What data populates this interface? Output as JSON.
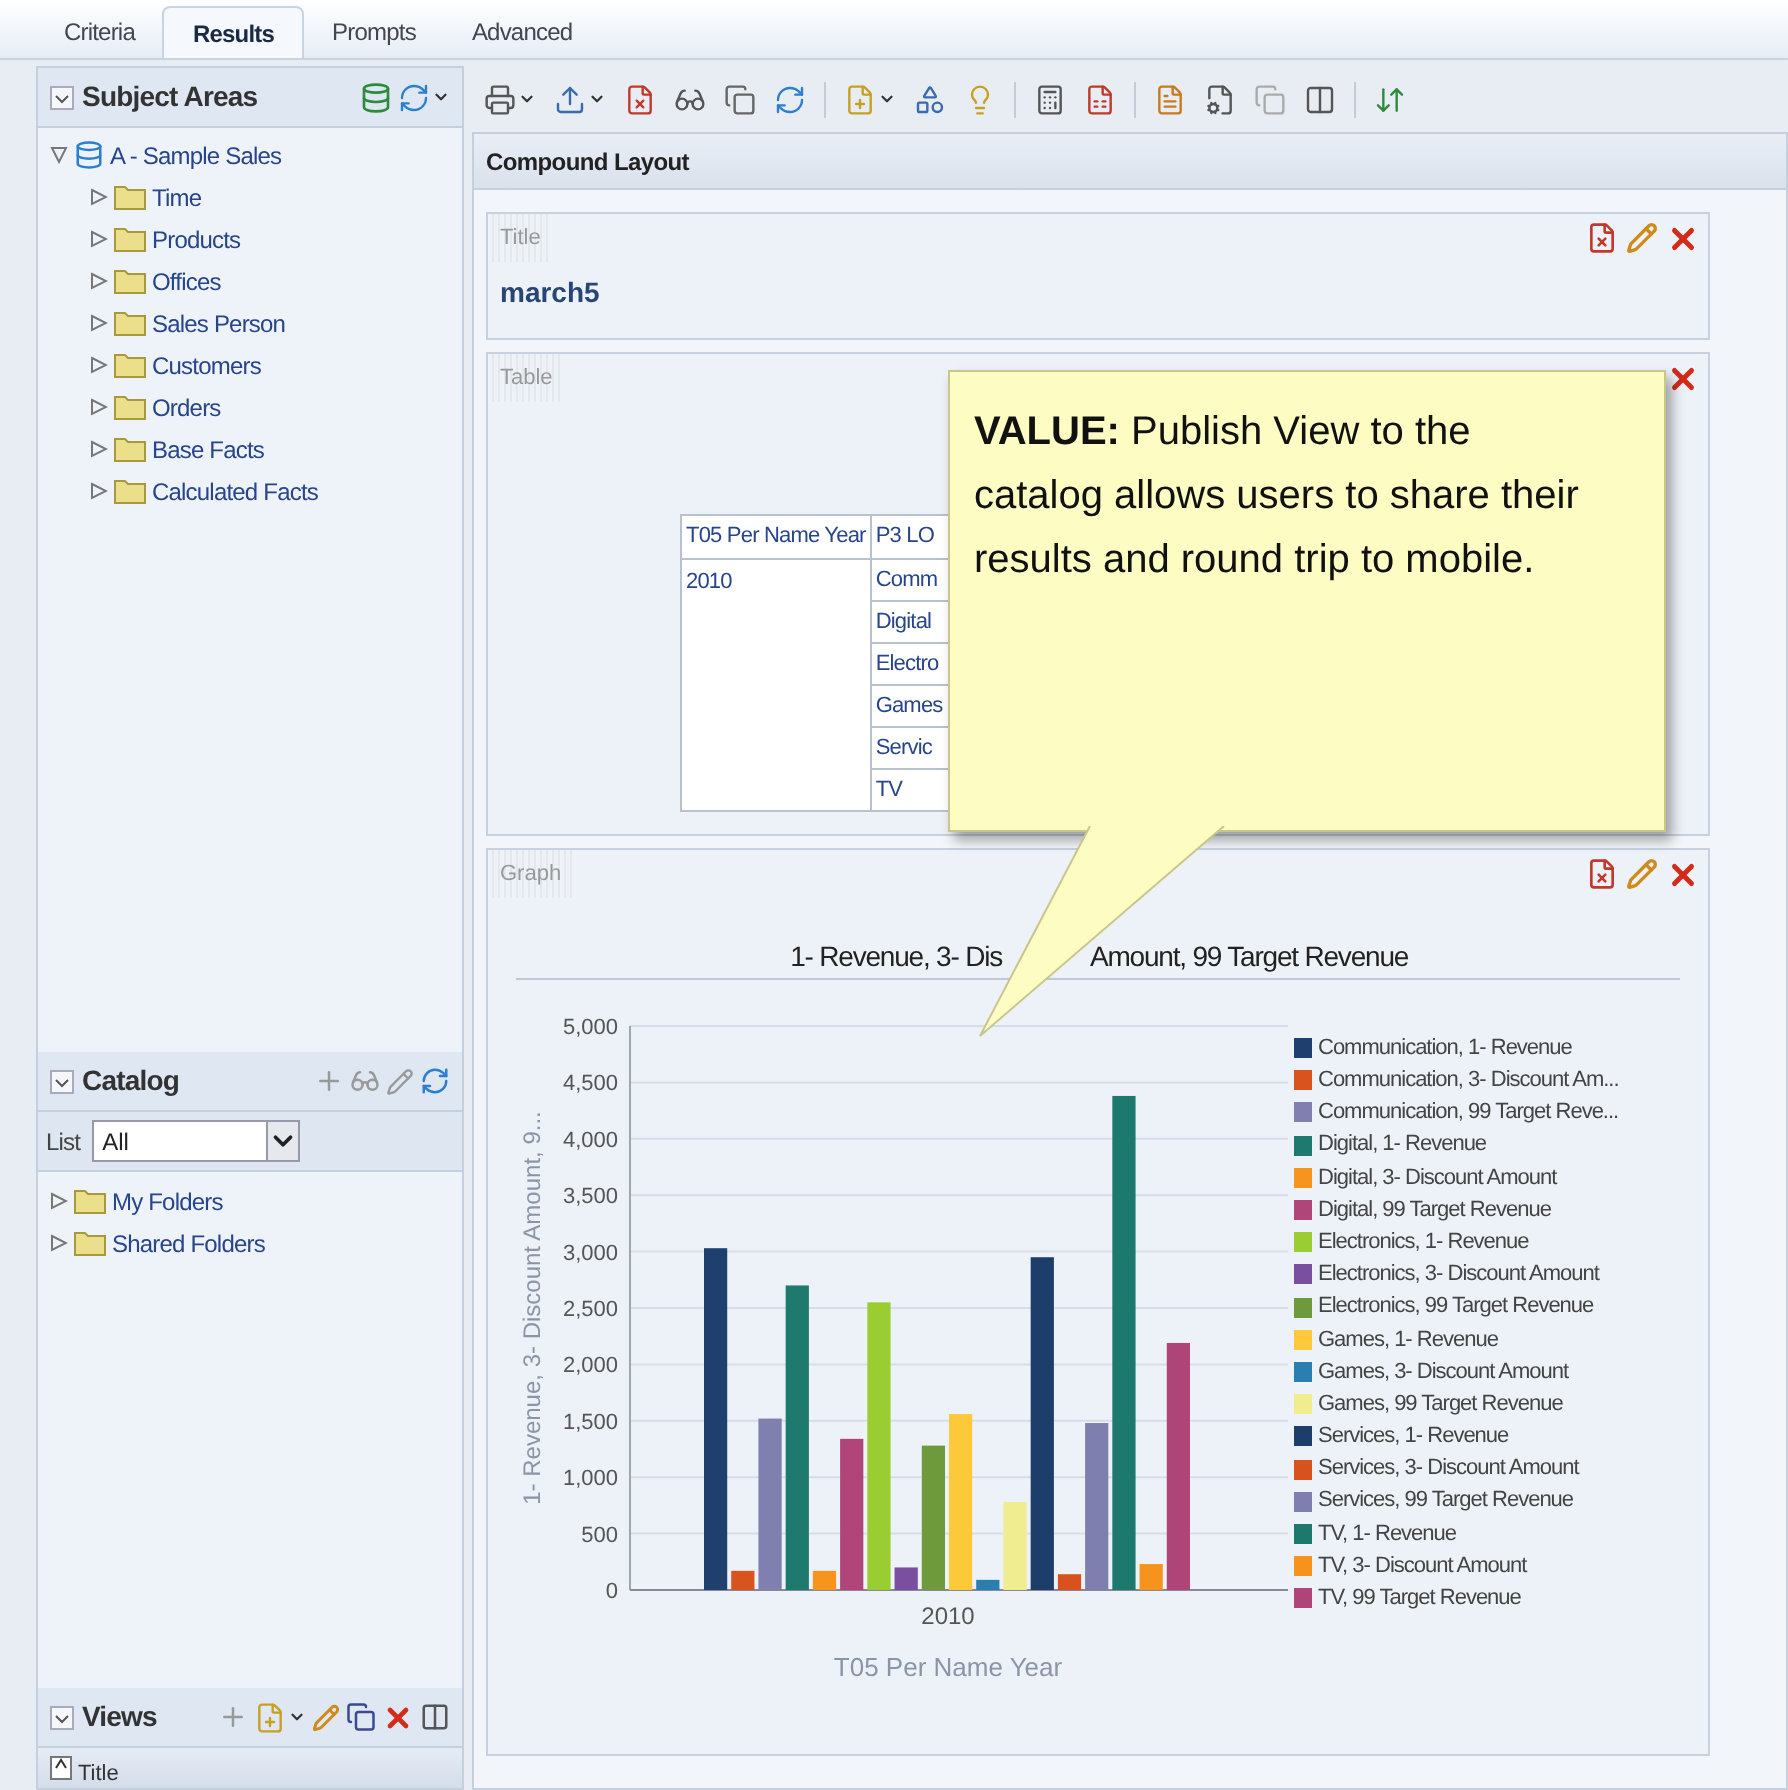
{
  "tabs": [
    {
      "label": "Criteria",
      "selected": false
    },
    {
      "label": "Results",
      "selected": true
    },
    {
      "label": "Prompts",
      "selected": false
    },
    {
      "label": "Advanced",
      "selected": false
    }
  ],
  "subject_areas": {
    "title": "Subject Areas",
    "tree": [
      {
        "label": "A - Sample Sales",
        "expanded": true,
        "children": [
          {
            "label": "Time",
            "expanded": false
          },
          {
            "label": "Products",
            "expanded": false
          },
          {
            "label": "Offices",
            "expanded": false
          },
          {
            "label": "Sales Person",
            "expanded": false
          },
          {
            "label": "Customers",
            "expanded": false
          },
          {
            "label": "Orders",
            "expanded": false
          },
          {
            "label": "Base Facts",
            "expanded": false
          },
          {
            "label": "Calculated Facts",
            "expanded": false
          }
        ]
      }
    ]
  },
  "catalog": {
    "title": "Catalog",
    "list_label": "List",
    "list_value": "All",
    "tree": [
      {
        "label": "My Folders",
        "expanded": false
      },
      {
        "label": "Shared Folders",
        "expanded": false
      }
    ]
  },
  "views": {
    "title": "Views",
    "items": [
      {
        "label": "Title"
      }
    ]
  },
  "layout": {
    "title": "Compound Layout"
  },
  "title_view": {
    "label": "Title",
    "value": "march5"
  },
  "table_view": {
    "label": "Table",
    "columns": [
      "T05 Per Name Year",
      "P3 LO"
    ],
    "year": "2010",
    "column_2_cells": [
      "Comm",
      "Digital",
      "Electro",
      "Games",
      "Servic",
      "TV"
    ]
  },
  "graph_view": {
    "label": "Graph",
    "title_left": "1- Revenue, 3- Dis",
    "title_right": "Amount, 99 Target Revenue",
    "chart_data": {
      "type": "bar",
      "grid": true,
      "legend": "right",
      "xlabel": "T05 Per Name Year",
      "ylabel": "1- Revenue, 3- Discount Amount, 9...",
      "categories": [
        "2010"
      ],
      "ylim": [
        0,
        5000
      ],
      "yticks": [
        {
          "value": 0,
          "label": "0"
        },
        {
          "value": 500,
          "label": "500"
        },
        {
          "value": 1000,
          "label": "1,000"
        },
        {
          "value": 1500,
          "label": "1,500"
        },
        {
          "value": 2000,
          "label": "2,000"
        },
        {
          "value": 2500,
          "label": "2,500"
        },
        {
          "value": 3000,
          "label": "3,000"
        },
        {
          "value": 3500,
          "label": "3,500"
        },
        {
          "value": 4000,
          "label": "4,000"
        },
        {
          "value": 4500,
          "label": "4,500"
        },
        {
          "value": 5000,
          "label": "5,000"
        }
      ],
      "series": [
        {
          "name": "Communication, 1- Revenue",
          "color": "#1f3f6e",
          "values": [
            3030
          ]
        },
        {
          "name": "Communication, 3- Discount Am...",
          "color": "#d9531e",
          "values": [
            170
          ]
        },
        {
          "name": "Communication, 99  Target Reve...",
          "color": "#8080b0",
          "values": [
            1520
          ]
        },
        {
          "name": "Digital, 1- Revenue",
          "color": "#1e7a6e",
          "values": [
            2700
          ]
        },
        {
          "name": "Digital, 3- Discount Amount",
          "color": "#f7941d",
          "values": [
            170
          ]
        },
        {
          "name": "Digital, 99  Target Revenue",
          "color": "#b0457a",
          "values": [
            1340
          ]
        },
        {
          "name": "Electronics, 1- Revenue",
          "color": "#9acd32",
          "values": [
            2550
          ]
        },
        {
          "name": "Electronics, 3- Discount Amount",
          "color": "#7a4fa0",
          "values": [
            200
          ]
        },
        {
          "name": "Electronics, 99  Target Revenue",
          "color": "#6e9a3c",
          "values": [
            1280
          ]
        },
        {
          "name": "Games, 1- Revenue",
          "color": "#fdc93a",
          "values": [
            1560
          ]
        },
        {
          "name": "Games, 3- Discount Amount",
          "color": "#2a7fb0",
          "values": [
            90
          ]
        },
        {
          "name": "Games, 99  Target Revenue",
          "color": "#f0ec90",
          "values": [
            780
          ]
        },
        {
          "name": "Services, 1- Revenue",
          "color": "#1d3d6b",
          "values": [
            2950
          ]
        },
        {
          "name": "Services, 3- Discount Amount",
          "color": "#d8521d",
          "values": [
            140
          ]
        },
        {
          "name": "Services, 99  Target Revenue",
          "color": "#7f7faf",
          "values": [
            1480
          ]
        },
        {
          "name": "TV, 1- Revenue",
          "color": "#1d796d",
          "values": [
            4380
          ]
        },
        {
          "name": "TV, 3- Discount Amount",
          "color": "#f6931c",
          "values": [
            230
          ]
        },
        {
          "name": "TV, 99  Target Revenue",
          "color": "#af4479",
          "values": [
            2190
          ]
        }
      ]
    }
  },
  "callout": {
    "text": "**VALUE:**  Publish View to the catalog allows users to share their results and round trip to mobile."
  }
}
